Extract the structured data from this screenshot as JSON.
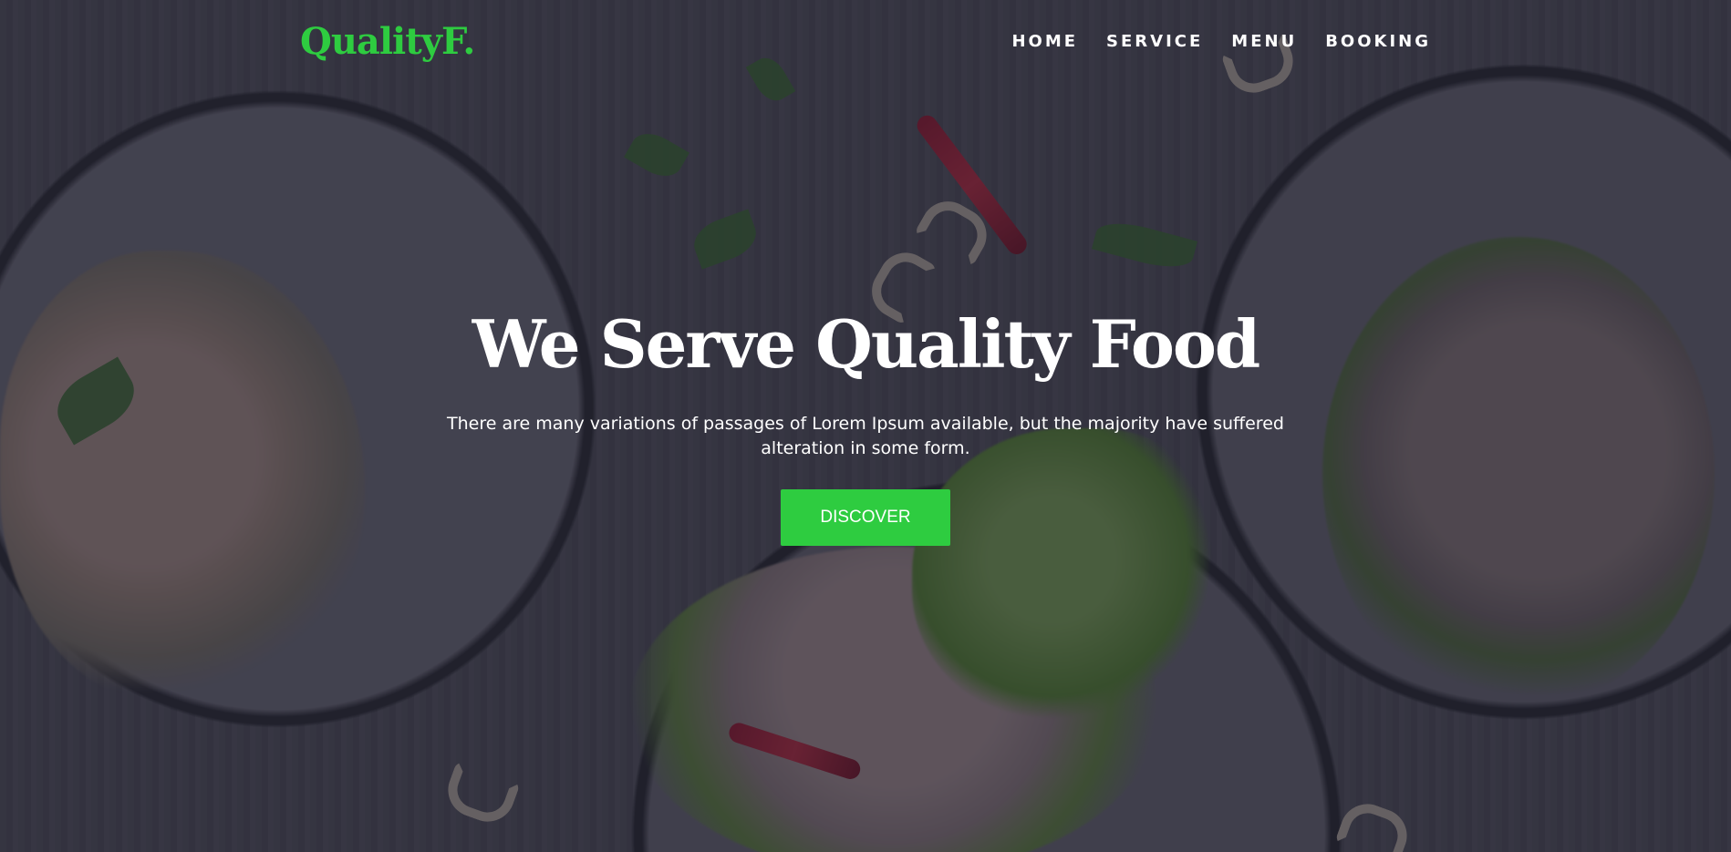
{
  "header": {
    "logo": "QualityF.",
    "nav": [
      {
        "label": "HOME"
      },
      {
        "label": "SERVICE"
      },
      {
        "label": "MENU"
      },
      {
        "label": "BOOKING"
      }
    ]
  },
  "hero": {
    "title": "We Serve Quality Food",
    "text": "There are many variations of passages of Lorem Ipsum available, but the majority have suffered alteration in some form.",
    "button_label": "DISCOVER"
  },
  "colors": {
    "accent": "#2ecc40",
    "overlay": "#1e1e2d",
    "text": "#ffffff"
  }
}
